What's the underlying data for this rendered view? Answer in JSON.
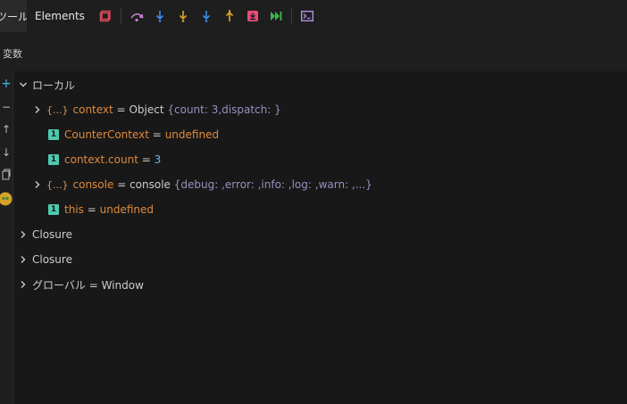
{
  "toolbar": {
    "active_tab": "ツール",
    "elements_tab": "Elements",
    "icons": [
      "pause-script-icon",
      "step-over-icon",
      "step-into-icon",
      "step-into-async-icon",
      "step-into-specific-icon",
      "step-out-icon",
      "break-on-exception-icon",
      "continue-icon",
      "console-icon"
    ]
  },
  "panel": {
    "title": "変数"
  },
  "gutter": {
    "add": "+",
    "remove": "−",
    "up": "↑",
    "down": "↓"
  },
  "scopes": {
    "local": {
      "label": "ローカル",
      "items": [
        {
          "name": "context",
          "eq": "=",
          "value": "Object",
          "preview": "{count: 3,dispatch: }",
          "kind": "object"
        },
        {
          "name": "CounterContext",
          "eq": "=",
          "value": "undefined",
          "kind": "undefined"
        },
        {
          "name": "context.count",
          "eq": "=",
          "value": "3",
          "kind": "number"
        },
        {
          "name": "console",
          "eq": "=",
          "value": "console",
          "preview": "{debug: ,error: ,info: ,log: ,warn: ,...}",
          "kind": "object"
        },
        {
          "name": "this",
          "eq": "=",
          "value": "undefined",
          "kind": "undefined"
        }
      ]
    },
    "closure1": {
      "label": "Closure"
    },
    "closure2": {
      "label": "Closure"
    },
    "global": {
      "label": "グローバル = Window"
    }
  },
  "badges": {
    "object": "{...}",
    "primitive": "1"
  },
  "colors": {
    "background": "#181818",
    "name": "#e08a3c",
    "number": "#6fb3e0",
    "preview": "#9a8fbf",
    "primitive_badge": "#4ec9b0"
  }
}
